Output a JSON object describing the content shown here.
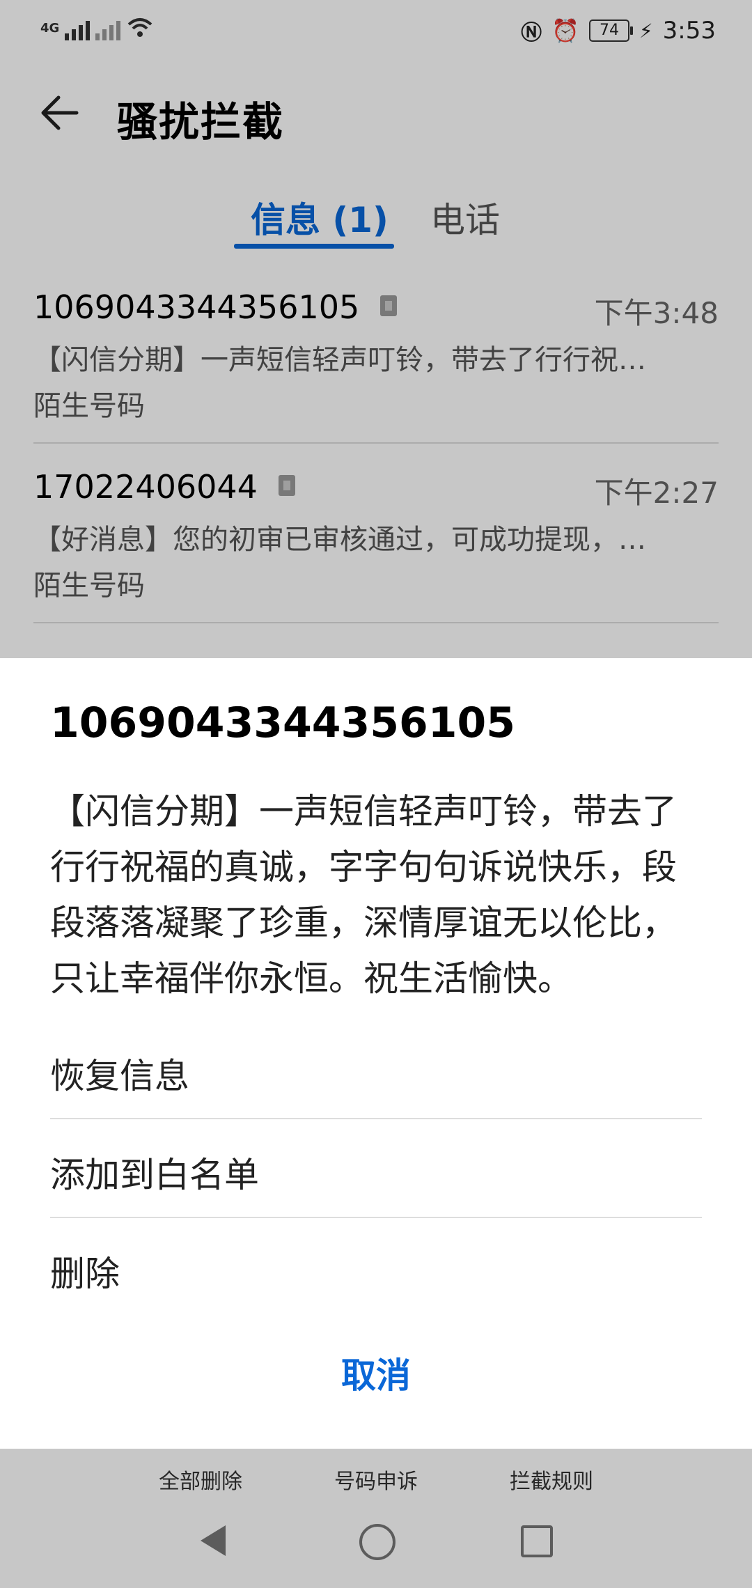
{
  "status_bar": {
    "network": "4G",
    "battery_level": "74",
    "time": "3:53"
  },
  "header": {
    "title": "骚扰拦截"
  },
  "tabs": [
    {
      "label": "信息 (1)",
      "selected": true
    },
    {
      "label": "电话",
      "selected": false
    }
  ],
  "messages": [
    {
      "number": "1069043344356105",
      "time": "下午3:48",
      "preview": "【闪信分期】一声短信轻声叮铃，带去了行行祝…",
      "tag": "陌生号码"
    },
    {
      "number": "17022406044",
      "time": "下午2:27",
      "preview": "【好消息】您的初审已审核通过，可成功提现，…",
      "tag": "陌生号码"
    }
  ],
  "bottom_actions": [
    "全部删除",
    "号码申诉",
    "拦截规则"
  ],
  "sheet": {
    "number": "1069043344356105",
    "content": "【闪信分期】一声短信轻声叮铃，带去了行行祝福的真诚，字字句句诉说快乐，段段落落凝聚了珍重，深情厚谊无以伦比，只让幸福伴你永恒。祝生活愉快。",
    "options": [
      "恢复信息",
      "添加到白名单",
      "删除"
    ],
    "cancel": "取消"
  },
  "colors": {
    "accent": "#0a67d7"
  }
}
